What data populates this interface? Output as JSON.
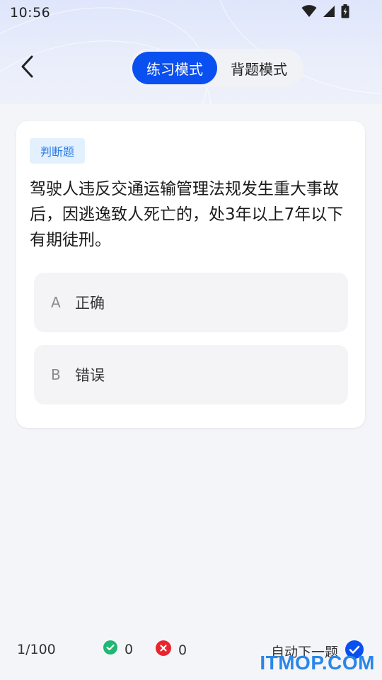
{
  "status_bar": {
    "time": "10:56"
  },
  "header": {
    "modes": [
      "练习模式",
      "背题模式"
    ],
    "active_mode": "练习模式"
  },
  "question": {
    "type_badge": "判断题",
    "text": "驾驶人违反交通运输管理法规发生重大事故后，因逃逸致人死亡的，处3年以上7年以下有期徒刑。",
    "options": [
      {
        "letter": "A",
        "text": "正确"
      },
      {
        "letter": "B",
        "text": "错误"
      }
    ]
  },
  "footer": {
    "progress": "1/100",
    "correct_count": "0",
    "wrong_count": "0",
    "auto_next_label": "自动下一题",
    "auto_next_checked": true
  },
  "watermark": "ITMOP.COM",
  "colors": {
    "accent": "#0a4ff0",
    "correct": "#22b573",
    "wrong": "#e8252f",
    "badge_bg": "#e2f1fd",
    "badge_text": "#2a79e8"
  }
}
